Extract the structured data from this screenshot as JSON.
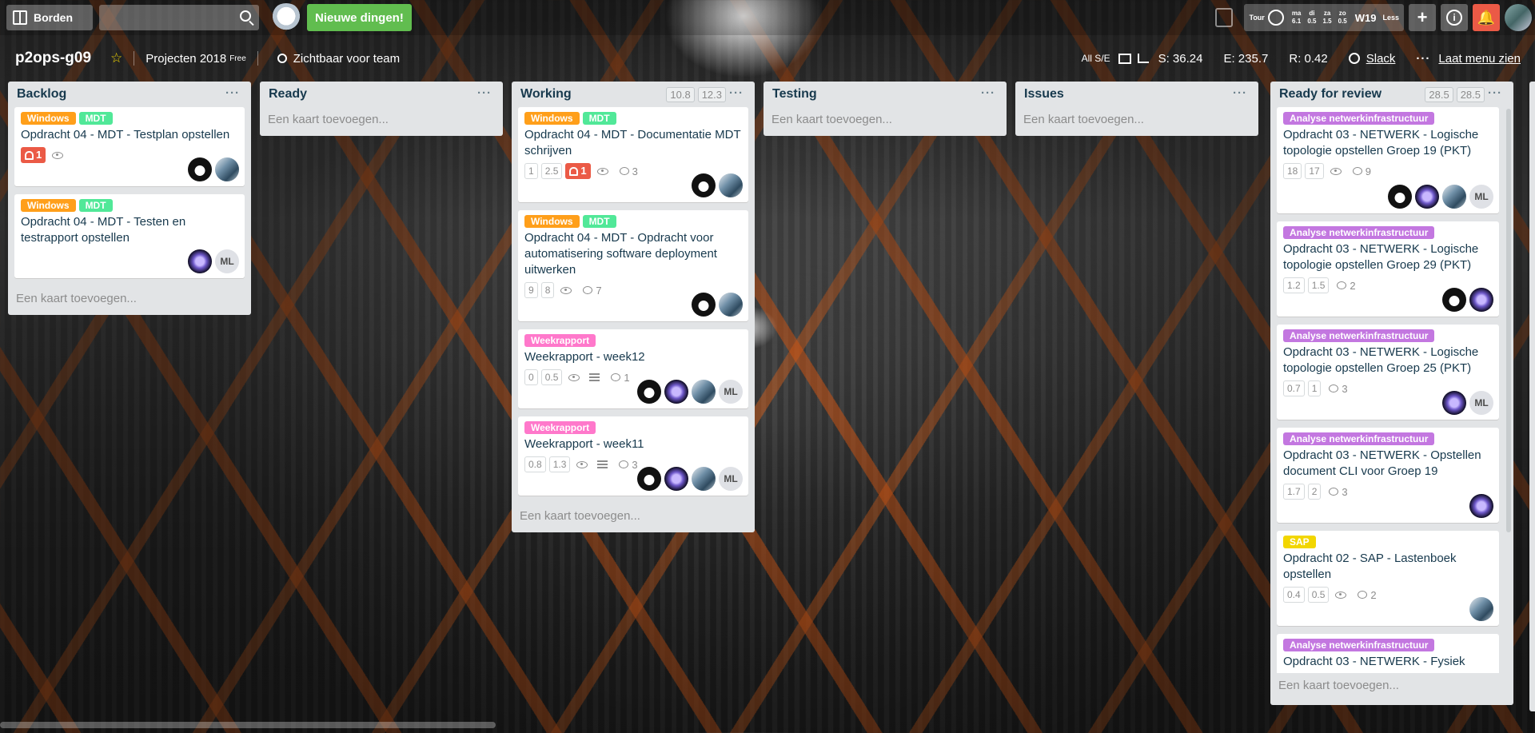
{
  "header": {
    "boards_label": "Borden",
    "search_placeholder": "",
    "news_label": "Nieuwe dingen!",
    "tour_label": "Tour",
    "days": [
      {
        "day": "ma",
        "value": "6.1"
      },
      {
        "day": "di",
        "value": "0.5"
      },
      {
        "day": "za",
        "value": "1.5"
      },
      {
        "day": "zo",
        "value": "0.5"
      }
    ],
    "week_label": "W19",
    "less_label": "Less",
    "add_label": "+",
    "info_label": "i"
  },
  "board": {
    "title": "p2ops-g09",
    "team": "Projecten 2018",
    "team_tag": "Free",
    "visibility": "Zichtbaar voor team",
    "all_label": "All S/E",
    "stat_s": "S: 36.24",
    "stat_e": "E: 235.7",
    "stat_r": "R: 0.42",
    "slack": "Slack",
    "menu": "Laat menu zien",
    "menu_dots": "···"
  },
  "lists": [
    {
      "title": "Backlog",
      "points": [],
      "cards": [
        {
          "labels": [
            {
              "text": "Windows",
              "color": "#ff9f1a"
            },
            {
              "text": "MDT",
              "color": "#51e898"
            }
          ],
          "title": "Opdracht 04 - MDT - Testplan opstellen",
          "alert": "1",
          "watch": true,
          "members": [
            "dog",
            "photo"
          ]
        },
        {
          "labels": [
            {
              "text": "Windows",
              "color": "#ff9f1a"
            },
            {
              "text": "MDT",
              "color": "#51e898"
            }
          ],
          "title": "Opdracht 04 - MDT - Testen en testrapport opstellen",
          "members": [
            "purple",
            "ML"
          ]
        }
      ],
      "add": "Een kaart toevoegen..."
    },
    {
      "title": "Ready",
      "points": [],
      "cards": [],
      "add": "Een kaart toevoegen..."
    },
    {
      "title": "Working",
      "points": [
        "10.8",
        "12.3"
      ],
      "cards": [
        {
          "labels": [
            {
              "text": "Windows",
              "color": "#ff9f1a"
            },
            {
              "text": "MDT",
              "color": "#51e898"
            }
          ],
          "title": "Opdracht 04 - MDT - Documentatie MDT schrijven",
          "pts": [
            "1",
            "2.5"
          ],
          "alert": "1",
          "watch": true,
          "comments": "3",
          "members": [
            "dog",
            "photo"
          ]
        },
        {
          "labels": [
            {
              "text": "Windows",
              "color": "#ff9f1a"
            },
            {
              "text": "MDT",
              "color": "#51e898"
            }
          ],
          "title": "Opdracht 04 - MDT - Opdracht voor automatisering software deployment uitwerken",
          "pts": [
            "9",
            "8"
          ],
          "watch": true,
          "comments": "7",
          "members": [
            "dog",
            "photo"
          ]
        },
        {
          "labels": [
            {
              "text": "Weekrapport",
              "color": "#ff78cb"
            }
          ],
          "title": "Weekrapport - week12",
          "pts": [
            "0",
            "0.5"
          ],
          "watch": true,
          "desc": true,
          "comments": "1",
          "members": [
            "dog",
            "purple",
            "photo",
            "ML"
          ]
        },
        {
          "labels": [
            {
              "text": "Weekrapport",
              "color": "#ff78cb"
            }
          ],
          "title": "Weekrapport - week11",
          "pts": [
            "0.8",
            "1.3"
          ],
          "watch": true,
          "desc": true,
          "comments": "3",
          "members": [
            "dog",
            "purple",
            "photo",
            "ML"
          ]
        }
      ],
      "add": "Een kaart toevoegen..."
    },
    {
      "title": "Testing",
      "points": [],
      "cards": [],
      "add": "Een kaart toevoegen..."
    },
    {
      "title": "Issues",
      "points": [],
      "cards": [],
      "add": "Een kaart toevoegen..."
    },
    {
      "title": "Ready for review",
      "points": [
        "28.5",
        "28.5"
      ],
      "cards": [
        {
          "labels": [
            {
              "text": "Analyse netwerkinfrastructuur",
              "color": "#c377e0"
            }
          ],
          "title": "Opdracht 03 - NETWERK - Logische topologie opstellen Groep 19 (PKT)",
          "pts": [
            "18",
            "17"
          ],
          "watch": true,
          "comments": "9",
          "members": [
            "dog",
            "purple",
            "photo",
            "ML"
          ]
        },
        {
          "labels": [
            {
              "text": "Analyse netwerkinfrastructuur",
              "color": "#c377e0"
            }
          ],
          "title": "Opdracht 03 - NETWERK - Logische topologie opstellen Groep 29 (PKT)",
          "pts": [
            "1.2",
            "1.5"
          ],
          "comments": "2",
          "members": [
            "dog",
            "purple"
          ]
        },
        {
          "labels": [
            {
              "text": "Analyse netwerkinfrastructuur",
              "color": "#c377e0"
            }
          ],
          "title": "Opdracht 03 - NETWERK - Logische topologie opstellen Groep 25 (PKT)",
          "pts": [
            "0.7",
            "1"
          ],
          "comments": "3",
          "members": [
            "purple",
            "ML"
          ]
        },
        {
          "labels": [
            {
              "text": "Analyse netwerkinfrastructuur",
              "color": "#c377e0"
            }
          ],
          "title": "Opdracht 03 - NETWERK - Opstellen document CLI voor Groep 19",
          "pts": [
            "1.7",
            "2"
          ],
          "comments": "3",
          "members": [
            "purple"
          ]
        },
        {
          "labels": [
            {
              "text": "SAP",
              "color": "#f2d600"
            }
          ],
          "title": "Opdracht 02 - SAP - Lastenboek opstellen",
          "pts": [
            "0.4",
            "0.5"
          ],
          "watch": true,
          "comments": "2",
          "members": [
            "photo"
          ]
        },
        {
          "labels": [
            {
              "text": "Analyse netwerkinfrastructuur",
              "color": "#c377e0"
            }
          ],
          "title": "Opdracht 03 - NETWERK - Fysiek",
          "members": []
        }
      ],
      "add": "Een kaart toevoegen..."
    }
  ]
}
